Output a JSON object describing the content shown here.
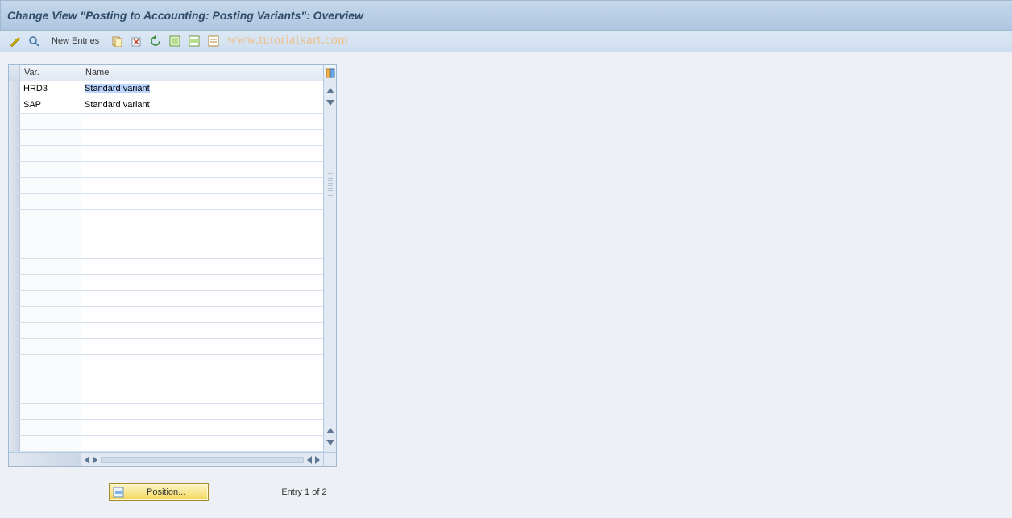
{
  "title": "Change View \"Posting to Accounting: Posting Variants\": Overview",
  "toolbar": {
    "new_entries_label": "New Entries"
  },
  "watermark": "www.tutorialkart.com",
  "table": {
    "headers": {
      "var": "Var.",
      "name": "Name"
    },
    "rows": [
      {
        "var": "HRD3",
        "name": "Standard variant"
      },
      {
        "var": "SAP",
        "name": "Standard variant"
      }
    ],
    "empty_rows": 21
  },
  "footer": {
    "position_label": "Position...",
    "entry_info": "Entry 1 of 2"
  }
}
